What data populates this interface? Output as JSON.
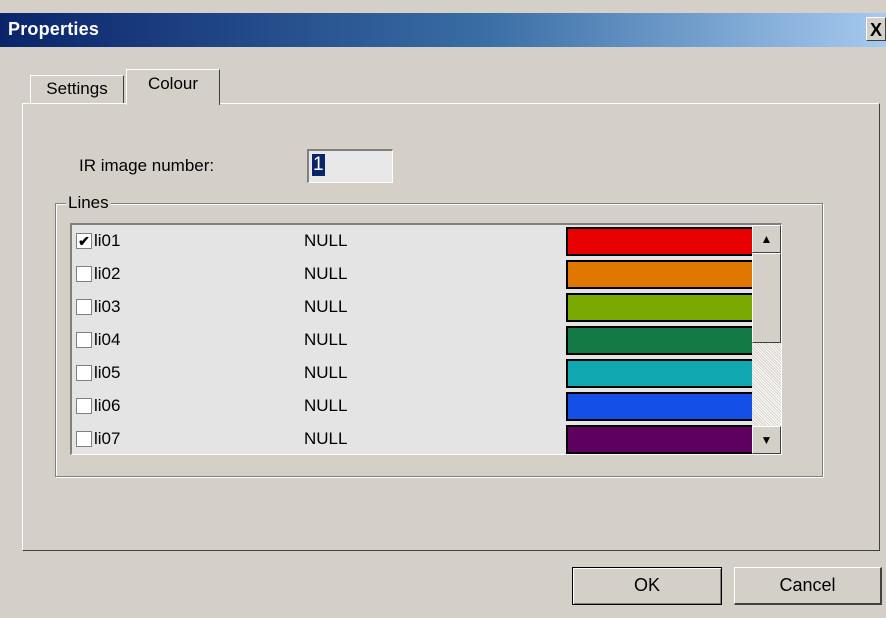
{
  "window": {
    "title": "Properties",
    "close_glyph": "X"
  },
  "tabs": [
    {
      "label": "Settings",
      "active": false
    },
    {
      "label": "Colour",
      "active": true
    }
  ],
  "ir_image": {
    "label": "IR image number:",
    "value": "1"
  },
  "lines": {
    "group_label": "Lines",
    "rows": [
      {
        "name": "li01",
        "value": "NULL",
        "checked": true,
        "color": "#e80000"
      },
      {
        "name": "li02",
        "value": "NULL",
        "checked": false,
        "color": "#e07800"
      },
      {
        "name": "li03",
        "value": "NULL",
        "checked": false,
        "color": "#7aaa00"
      },
      {
        "name": "li04",
        "value": "NULL",
        "checked": false,
        "color": "#137a46"
      },
      {
        "name": "li05",
        "value": "NULL",
        "checked": false,
        "color": "#10a8b0"
      },
      {
        "name": "li06",
        "value": "NULL",
        "checked": false,
        "color": "#1450e8"
      },
      {
        "name": "li07",
        "value": "NULL",
        "checked": false,
        "color": "#5e005e"
      }
    ]
  },
  "buttons": {
    "ok": "OK",
    "cancel": "Cancel"
  }
}
